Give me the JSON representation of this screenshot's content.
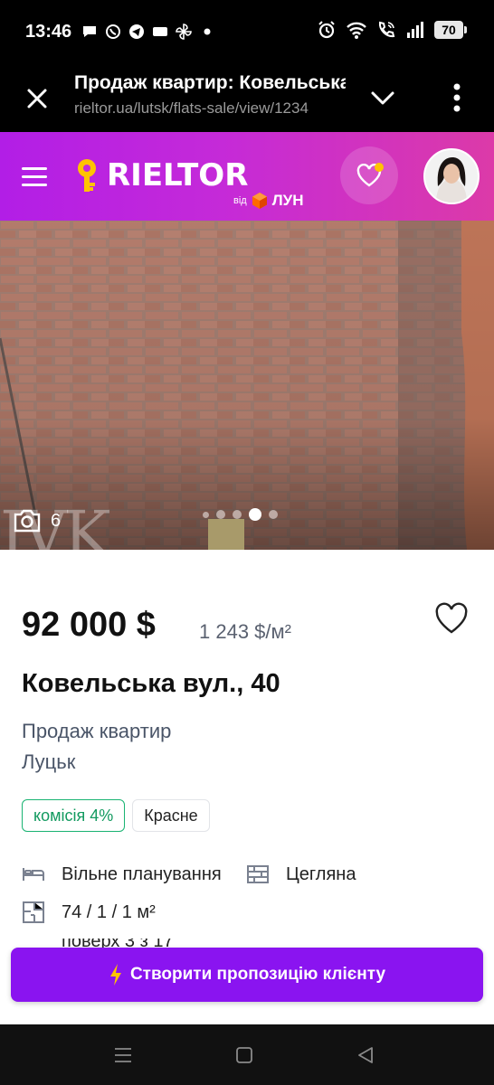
{
  "status_bar": {
    "time": "13:46",
    "battery": "70",
    "left_icons": [
      "chat-icon",
      "viber-icon",
      "telegram-icon",
      "app-icon",
      "pinwheel-icon",
      "dot-icon"
    ],
    "right_icons": [
      "alarm-icon",
      "wifi-icon",
      "wifi-call-icon",
      "signal-icon",
      "battery-icon"
    ]
  },
  "browser_tab": {
    "title": "Продаж квартир: Ковельська",
    "url": "rieltor.ua/lutsk/flats-sale/view/1234"
  },
  "site_header": {
    "logo_text": "RIELTOR",
    "logo_sub_prefix": "від",
    "logo_sub_brand": "ЛУН",
    "brand_color": "#b21ee6",
    "accent_yellow": "#ffc300"
  },
  "photo": {
    "count": "6",
    "watermark": "IVK",
    "slides_total": 5,
    "active_slide": 4
  },
  "listing": {
    "price": "92 000 $",
    "price_per_m2": "1 243 $/м²",
    "address": "Ковельська вул., 40",
    "deal_type": "Продаж квартир",
    "city": "Луцьк",
    "tags": [
      {
        "label": "комісія 4%",
        "color": "#19b372"
      },
      {
        "label": "Красне"
      }
    ],
    "features": {
      "layout": "Вільне планування",
      "material": "Цегляна",
      "area": "74 / 1 / 1 м²",
      "floor": "поверх 3 з 17"
    }
  },
  "cta": {
    "label": "Створити пропозицію клієнту",
    "color": "#8a14f0"
  },
  "nav_bar": {
    "buttons": [
      "menu-icon",
      "home-icon",
      "back-icon"
    ]
  }
}
